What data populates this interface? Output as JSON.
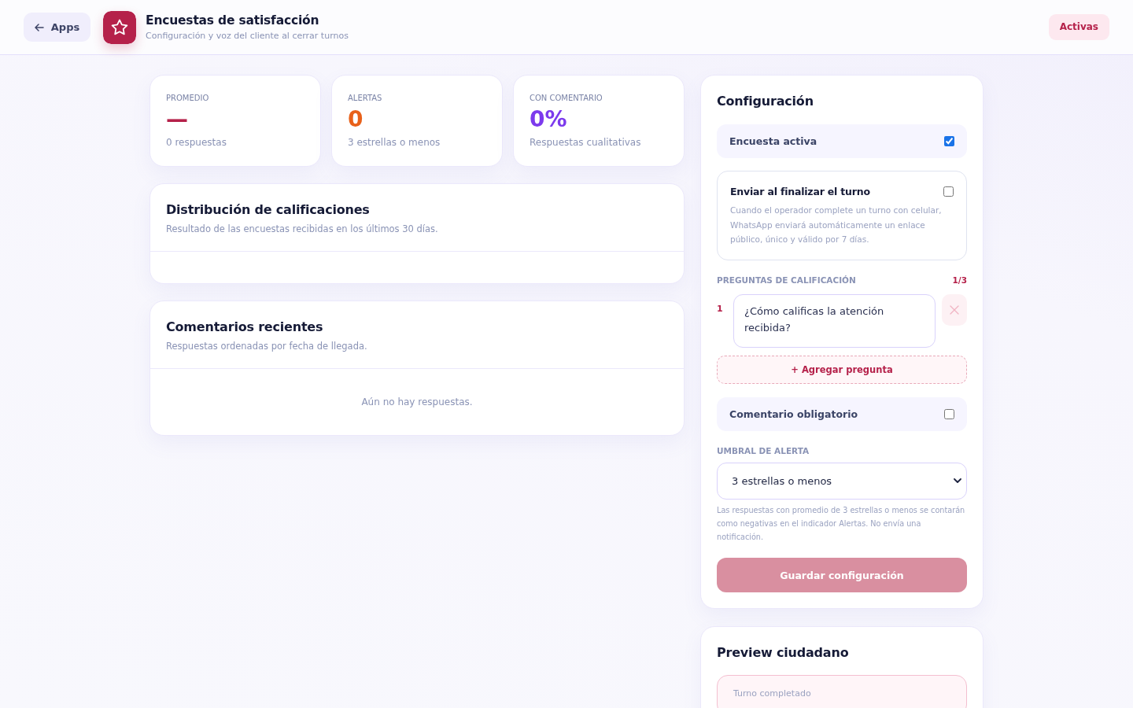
{
  "header": {
    "back_button": "Apps",
    "title": "Encuestas de satisfacción",
    "subtitle": "Configuración y voz del cliente al cerrar turnos",
    "status_badge": "Activas"
  },
  "stats": [
    {
      "label": "PROMEDIO",
      "value": "—",
      "caption": "0 respuestas",
      "color": "#b5214a"
    },
    {
      "label": "ALERTAS",
      "value": "0",
      "caption": "3 estrellas o menos",
      "color": "#e8611a"
    },
    {
      "label": "CON COMENTARIO",
      "value": "0%",
      "caption": "Respuestas cualitativas",
      "color": "#7c3aed"
    }
  ],
  "distribution": {
    "title": "Distribución de calificaciones",
    "subtitle": "Resultado de las encuestas recibidas en los últimos 30 días."
  },
  "comments": {
    "title": "Comentarios recientes",
    "subtitle": "Respuestas ordenadas por fecha de llegada.",
    "empty_message": "Aún no hay respuestas."
  },
  "config": {
    "title": "Configuración",
    "survey_active": {
      "label": "Encuesta activa",
      "checked": true
    },
    "send_on_finish": {
      "label": "Enviar al finalizar el turno",
      "description": "Cuando el operador complete un turno con celular, WhatsApp enviará automáticamente un enlace público, único y válido por 7 días.",
      "checked": false
    },
    "questions": {
      "label": "PREGUNTAS DE CALIFICACIÓN",
      "count": "1/3",
      "items": [
        {
          "number": "1",
          "text": "¿Cómo calificas la atención recibida?"
        }
      ],
      "add_button": "+ Agregar pregunta"
    },
    "required_comment": {
      "label": "Comentario obligatorio",
      "checked": false
    },
    "alert_threshold": {
      "label": "UMBRAL DE ALERTA",
      "value": "3 estrellas o menos",
      "help": "Las respuestas con promedio de 3 estrellas o menos se contarán como negativas en el indicador Alertas. No envía una notificación."
    },
    "save_button": {
      "label": "Guardar configuración",
      "disabled": true
    }
  },
  "preview": {
    "title": "Preview ciudadano",
    "status_text": "Turno completado"
  }
}
